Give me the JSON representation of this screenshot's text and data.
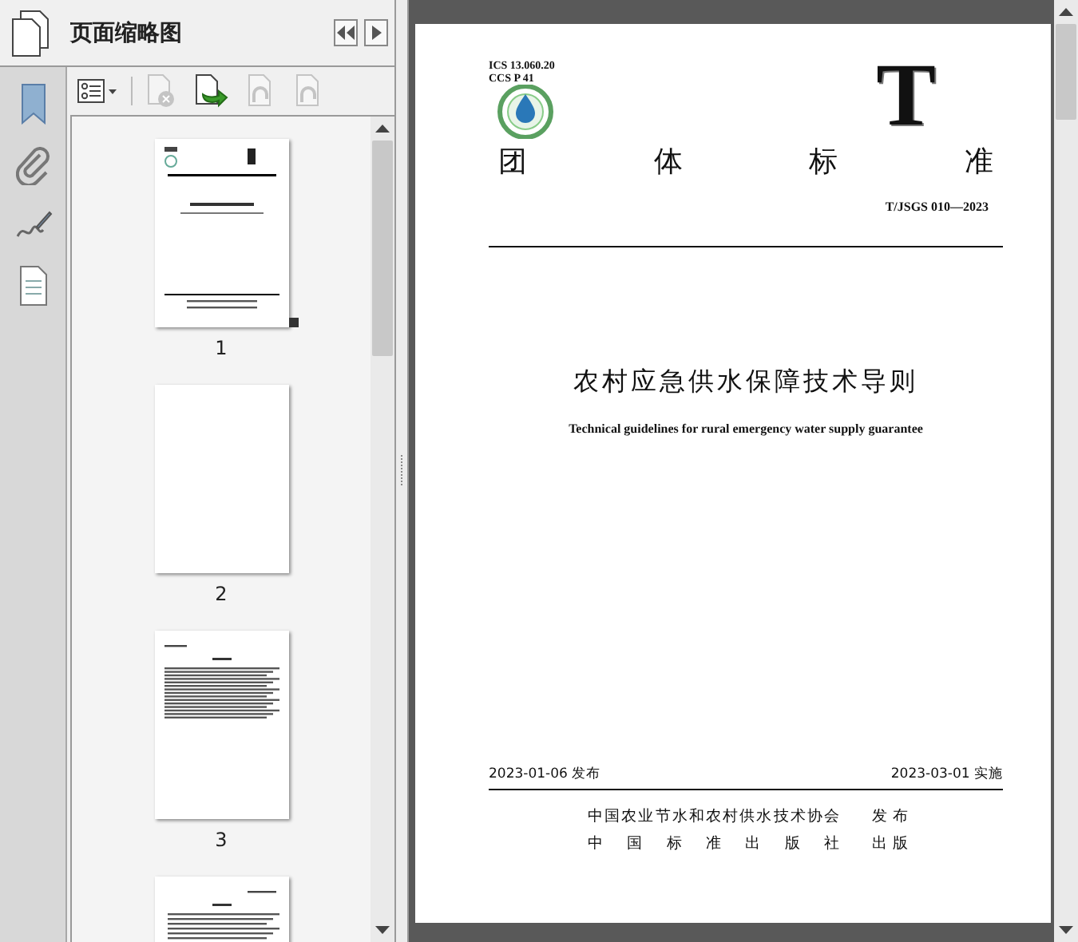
{
  "panel": {
    "title": "页面缩略图"
  },
  "toolbar": [
    {
      "kind": "options",
      "disabled": false
    },
    {
      "kind": "delete",
      "disabled": true
    },
    {
      "kind": "insert",
      "disabled": false
    },
    {
      "kind": "rotate-left",
      "disabled": true
    },
    {
      "kind": "rotate-right",
      "disabled": true
    }
  ],
  "thumbnails": [
    {
      "kind": "cover",
      "label": "1",
      "selected": true
    },
    {
      "kind": "blank",
      "label": "2",
      "selected": false
    },
    {
      "kind": "contents",
      "label": "3",
      "selected": false
    },
    {
      "kind": "foreword",
      "selected": false
    }
  ],
  "document": {
    "ics": "ICS 13.060.20",
    "ccs": "CCS P 41",
    "mark": "T",
    "category": "团 体 标 准",
    "code": "T/JSGS 010—2023",
    "title": "农村应急供水保障技术导则",
    "subtitle_en": "Technical guidelines for rural emergency water supply guarantee",
    "issued": "2023-01-06 发布",
    "implemented": "2023-03-01 实施",
    "publishers": [
      {
        "name": "中国农业节水和农村供水技术协会",
        "role": "发 布"
      },
      {
        "name": "中 国 标 准 出 版 社",
        "role": "出 版"
      }
    ]
  }
}
